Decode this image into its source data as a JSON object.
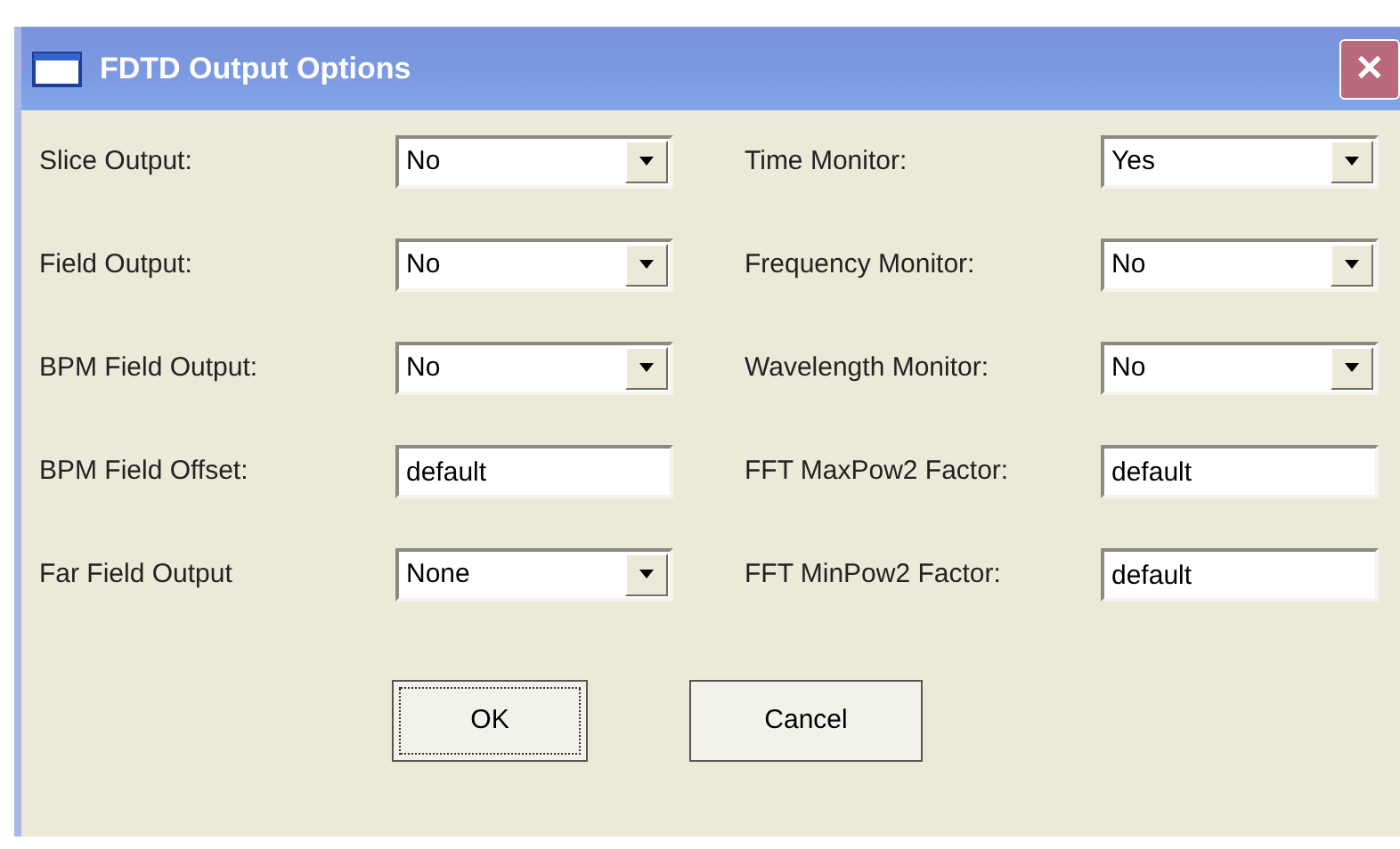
{
  "window": {
    "title": "FDTD Output Options",
    "close": "✕"
  },
  "columns": [
    [
      {
        "kind": "select",
        "label": "Slice Output:",
        "value": "No"
      },
      {
        "kind": "select",
        "label": "Field Output:",
        "value": "No"
      },
      {
        "kind": "select",
        "label": "BPM Field Output:",
        "value": "No"
      },
      {
        "kind": "text",
        "label": "BPM Field Offset:",
        "value": "default"
      },
      {
        "kind": "select",
        "label": "Far Field Output",
        "value": "None"
      }
    ],
    [
      {
        "kind": "select",
        "label": "Time Monitor:",
        "value": "Yes"
      },
      {
        "kind": "select",
        "label": "Frequency Monitor:",
        "value": "No"
      },
      {
        "kind": "select",
        "label": "Wavelength Monitor:",
        "value": "No"
      },
      {
        "kind": "text",
        "label": "FFT MaxPow2 Factor:",
        "value": "default"
      },
      {
        "kind": "text",
        "label": "FFT MinPow2 Factor:",
        "value": "default"
      }
    ]
  ],
  "buttons": [
    "OK",
    "Cancel"
  ]
}
